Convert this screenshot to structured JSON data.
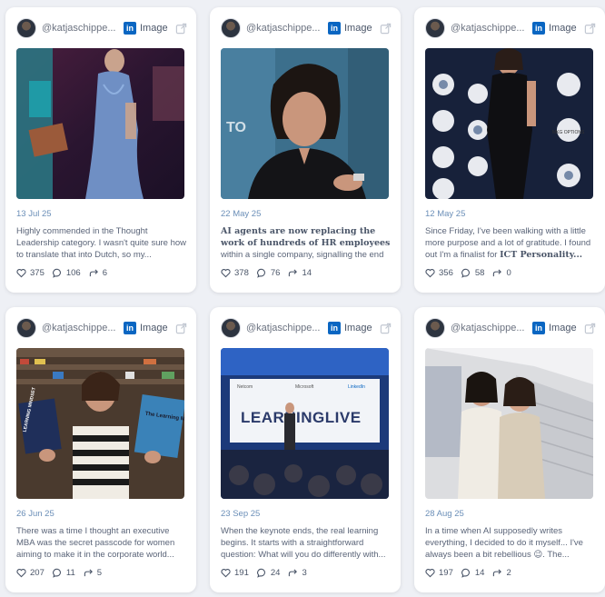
{
  "colors": {
    "accent": "#0a66c2",
    "date": "#6b8fb8",
    "card_bg": "#ffffff",
    "page_bg": "#eef0f5"
  },
  "posts": [
    {
      "handle": "@katjaschippe...",
      "type_label": "Image",
      "date": "13 Jul 25",
      "text_pre": "Highly commended in the Thought Leadership category. I wasn't quite sure how to translate that into Dutch, so my...",
      "text_bold": "",
      "text_post": "",
      "likes": "375",
      "comments": "106",
      "shares": "6"
    },
    {
      "handle": "@katjaschippe...",
      "type_label": "Image",
      "date": "22 May 25",
      "text_pre": "",
      "text_bold": "AI agents are now replacing the work of hundreds of HR employees",
      "text_post": " within a single company, signalling the end of traditiona...",
      "likes": "378",
      "comments": "76",
      "shares": "14"
    },
    {
      "handle": "@katjaschippe...",
      "type_label": "Image",
      "date": "12 May 25",
      "text_pre": "Since Friday, I've been walking with a little more purpose and a lot of gratitude. I found out I'm a finalist for ",
      "text_bold": "ICT Personality...",
      "text_post": "",
      "likes": "356",
      "comments": "58",
      "shares": "0"
    },
    {
      "handle": "@katjaschippe...",
      "type_label": "Image",
      "date": "26 Jun 25",
      "text_pre": "There was a time I thought an executive MBA was the secret passcode for women aiming to make it in the corporate world...",
      "text_bold": "",
      "text_post": "",
      "likes": "207",
      "comments": "11",
      "shares": "5"
    },
    {
      "handle": "@katjaschippe...",
      "type_label": "Image",
      "date": "23 Sep 25",
      "text_pre": "When the keynote ends, the real learning begins. It starts with a straightforward question: What will you do differently with...",
      "text_bold": "",
      "text_post": "",
      "likes": "191",
      "comments": "24",
      "shares": "3"
    },
    {
      "handle": "@katjaschippe...",
      "type_label": "Image",
      "date": "28 Aug 25",
      "text_pre": "In a time when AI supposedly writes everything, I decided to do it myself... I've always been a bit rebellious 😉. The...",
      "text_bold": "",
      "text_post": "",
      "likes": "197",
      "comments": "14",
      "shares": "2"
    }
  ],
  "image_texts": {
    "p2_corner": "TO",
    "p3_brand": "MKG OPTIONS",
    "p4_book_left": "LEARNING MINDSET",
    "p4_book_right": "The Learning Mindset",
    "p5_banner": "LEARNINGLIVE",
    "p5_sponsor1": "Netcom",
    "p5_sponsor2": "Microsoft",
    "p5_sponsor3": "LinkedIn"
  },
  "icons": {
    "like": "heart-icon",
    "comment": "comment-icon",
    "share": "share-icon",
    "open": "external-link-icon",
    "network": "linkedin-icon"
  }
}
